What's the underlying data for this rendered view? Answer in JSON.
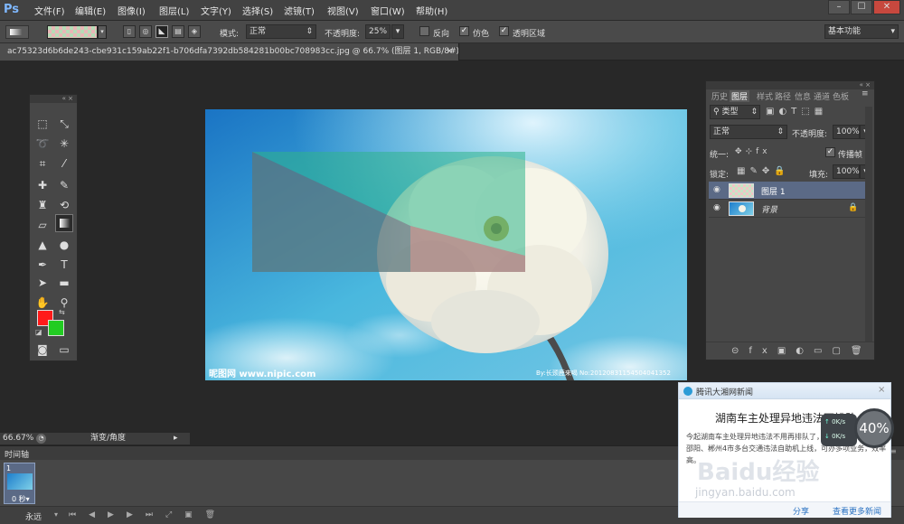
{
  "app": {
    "logo": "Ps"
  },
  "menu": [
    "文件(F)",
    "编辑(E)",
    "图像(I)",
    "图层(L)",
    "文字(Y)",
    "选择(S)",
    "滤镜(T)",
    "视图(V)",
    "窗口(W)",
    "帮助(H)"
  ],
  "window_buttons": [
    "–",
    "☐",
    "✕"
  ],
  "options": {
    "mode_label": "模式:",
    "mode_value": "正常",
    "opacity_label": "不透明度:",
    "opacity_value": "25%",
    "reverse": "反向",
    "dither": "仿色",
    "transparency": "透明区域",
    "workspace": "基本功能"
  },
  "document": {
    "tab": "ac75323d6b6de243-cbe931c159ab22f1-b706dfa7392db584281b00bc708983cc.jpg @ 66.7% (图层 1, RGB/8#) *",
    "close": "×"
  },
  "canvas": {
    "watermark_left": "昵图网 www.nipic.com",
    "watermark_right": "By:长颈鹿来喝 No:20120831154504041352"
  },
  "layers_panel": {
    "tabs": [
      "历史",
      "图层",
      "样式",
      "路径",
      "信息",
      "通道",
      "色板"
    ],
    "filter": "类型",
    "blend_mode": "正常",
    "opacity_label": "不透明度:",
    "opacity_value": "100%",
    "unify_label": "统一:",
    "propagate": "传播帧 1",
    "lock_label": "锁定:",
    "fill_label": "填充:",
    "fill_value": "100%",
    "layers": [
      {
        "name": "图层 1"
      },
      {
        "name": "背景"
      }
    ]
  },
  "status": {
    "zoom": "66.67%",
    "info": "渐变/角度"
  },
  "timeline": {
    "tab": "时间轴",
    "frame_number": "1",
    "frame_delay": "0 秒▾",
    "loop": "永远"
  },
  "news_popup": {
    "source": "腾讯大湘网新闻",
    "headline": "湖南车主处理异地违法不排队",
    "body": "今起湖南车主处理异地违法不用再排队了，目前长沙、株洲、邵阳、郴州4市多台交通违法自助机上线，可办多项业务，效率高。",
    "share": "分享",
    "more": "查看更多新闻"
  },
  "speed_widget": {
    "up": "0K/s",
    "down": "0K/s",
    "percent": "40%"
  },
  "overlay_watermark": {
    "brand": "Baidu经验",
    "url": "jingyan.baidu.com"
  }
}
